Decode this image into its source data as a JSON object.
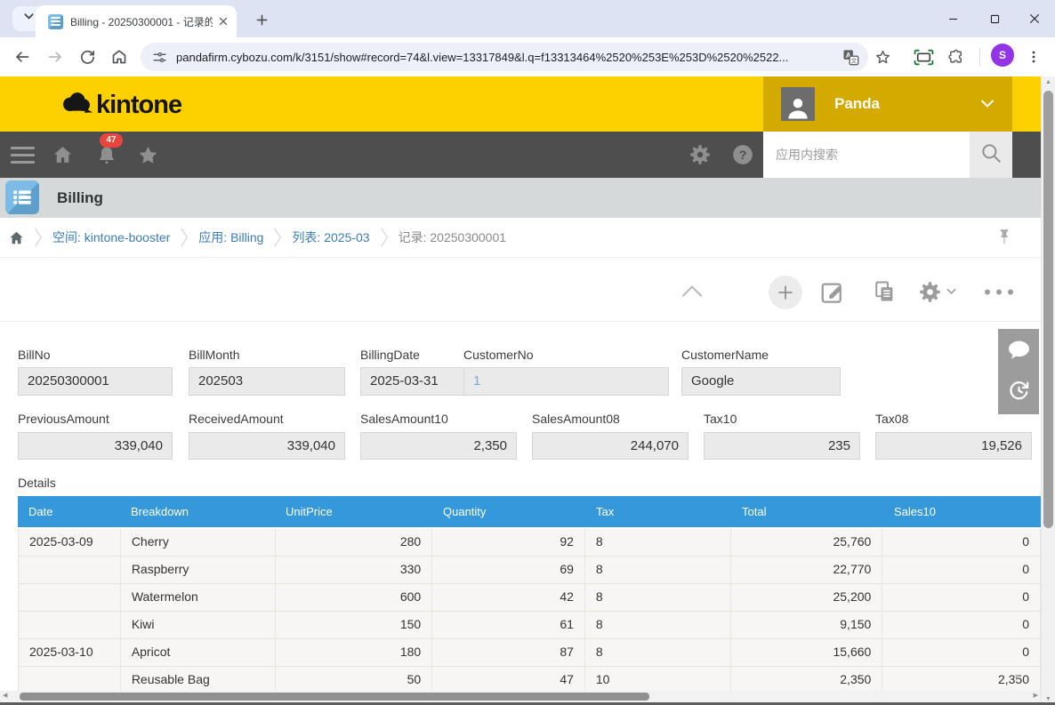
{
  "browser": {
    "tab_title": "Billing - 20250300001 - 记录的",
    "url": "pandafirm.cybozu.com/k/3151/show#record=74&l.view=13317849&l.q=f13313464%2520%253E%253D%2520%2522...",
    "profile_initial": "S"
  },
  "header": {
    "logo_text": "kintone",
    "user_name": "Panda",
    "notification_count": "47",
    "search_placeholder": "应用内搜索"
  },
  "app": {
    "title": "Billing",
    "details_label": "Details"
  },
  "breadcrumb": [
    {
      "label": "空间: kintone-booster",
      "type": "link"
    },
    {
      "label": "应用: Billing",
      "type": "link"
    },
    {
      "label": "列表: 2025-03",
      "type": "link"
    },
    {
      "label": "记录: 20250300001",
      "type": "current"
    }
  ],
  "fields": {
    "row1": [
      {
        "label": "BillNo",
        "value": "20250300001"
      },
      {
        "label": "BillMonth",
        "value": "202503"
      },
      {
        "label": "BillingDate",
        "value": "2025-03-31"
      },
      {
        "label": "CustomerNo",
        "value": "1"
      },
      {
        "label": "CustomerName",
        "value": "Google"
      }
    ],
    "row2": [
      {
        "label": "PreviousAmount",
        "value": "339,040"
      },
      {
        "label": "ReceivedAmount",
        "value": "339,040"
      },
      {
        "label": "SalesAmount10",
        "value": "2,350"
      },
      {
        "label": "SalesAmount08",
        "value": "244,070"
      },
      {
        "label": "Tax10",
        "value": "235"
      },
      {
        "label": "Tax08",
        "value": "19,526"
      }
    ]
  },
  "table": {
    "columns": [
      "Date",
      "Breakdown",
      "UnitPrice",
      "Quantity",
      "Tax",
      "Total",
      "Sales10"
    ],
    "rows": [
      [
        "2025-03-09",
        "Cherry",
        "280",
        "92",
        "8",
        "25,760",
        "0"
      ],
      [
        "",
        "Raspberry",
        "330",
        "69",
        "8",
        "22,770",
        "0"
      ],
      [
        "",
        "Watermelon",
        "600",
        "42",
        "8",
        "25,200",
        "0"
      ],
      [
        "",
        "Kiwi",
        "150",
        "61",
        "8",
        "9,150",
        "0"
      ],
      [
        "2025-03-10",
        "Apricot",
        "180",
        "87",
        "8",
        "15,660",
        "0"
      ],
      [
        "",
        "Reusable Bag",
        "50",
        "47",
        "10",
        "2,350",
        "2,350"
      ]
    ]
  },
  "colors": {
    "brand_yellow": "#fdd000",
    "user_area_yellow": "#d4a900",
    "toolbar_dark": "#4e4e4e",
    "table_header_blue": "#3498db",
    "link_blue": "#3b7cba",
    "badge_red": "#e8463c",
    "avatar_purple": "#9334e6",
    "field_box_gray": "#eaeaea"
  }
}
